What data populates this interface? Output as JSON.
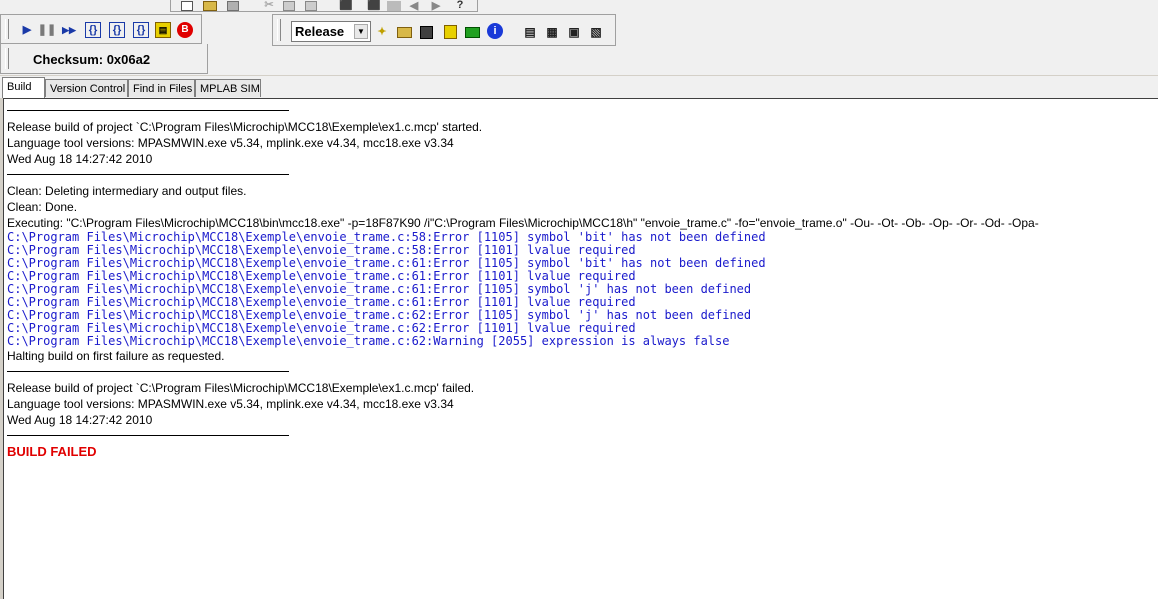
{
  "toolbar": {
    "top_icons": [
      "new-file-icon",
      "open-folder-icon",
      "save-icon",
      "cut-icon",
      "copy-icon",
      "paste-icon",
      "undo-icon",
      "redo-icon",
      "help-icon"
    ],
    "debug_icons": [
      {
        "name": "run-icon",
        "glyph": "▶",
        "color": "#1a3aa8"
      },
      {
        "name": "halt-icon",
        "glyph": "❚❚",
        "color": "#7a7a7a"
      },
      {
        "name": "animate-icon",
        "glyph": "▶▶",
        "color": "#1a3aa8"
      },
      {
        "name": "step-into-icon",
        "glyph": "{}",
        "color": "#1a3aa8"
      },
      {
        "name": "step-over-icon",
        "glyph": "{}",
        "color": "#1a3aa8"
      },
      {
        "name": "step-out-icon",
        "glyph": "{}",
        "color": "#1a3aa8"
      },
      {
        "name": "reset-icon",
        "glyph": "▤",
        "color": "#b8a000"
      },
      {
        "name": "breakpoint-icon",
        "glyph": "B",
        "color": "#ffffff"
      }
    ],
    "build_config": "Release",
    "build_icons": [
      "new-project-icon",
      "open-project-icon",
      "save-project-icon",
      "build-icon",
      "make-icon",
      "info-icon",
      "project-view-icon",
      "output-icon",
      "memory-icon",
      "watch-icon"
    ],
    "checksum_label": "Checksum:  0x06a2"
  },
  "tabs": [
    "Build",
    "Version Control",
    "Find in Files",
    "MPLAB SIM"
  ],
  "output": {
    "started_1": "Release build of project `C:\\Program Files\\Microchip\\MCC18\\Exemple\\ex1.c.mcp' started.",
    "versions_1": "Language tool versions: MPASMWIN.exe v5.34, mplink.exe v4.34, mcc18.exe v3.34",
    "date_1": "Wed Aug 18 14:27:42 2010",
    "clean_1": "Clean: Deleting intermediary and output files.",
    "clean_2": "Clean: Done.",
    "executing": "Executing: \"C:\\Program Files\\Microchip\\MCC18\\bin\\mcc18.exe\" -p=18F87K90 /i\"C:\\Program Files\\Microchip\\MCC18\\h\" \"envoie_trame.c\" -fo=\"envoie_trame.o\" -Ou- -Ot- -Ob- -Op- -Or- -Od- -Opa-",
    "errors": [
      "C:\\Program Files\\Microchip\\MCC18\\Exemple\\envoie_trame.c:58:Error [1105] symbol 'bit' has not been defined",
      "C:\\Program Files\\Microchip\\MCC18\\Exemple\\envoie_trame.c:58:Error [1101] lvalue required",
      "C:\\Program Files\\Microchip\\MCC18\\Exemple\\envoie_trame.c:61:Error [1105] symbol 'bit' has not been defined",
      "C:\\Program Files\\Microchip\\MCC18\\Exemple\\envoie_trame.c:61:Error [1101] lvalue required",
      "C:\\Program Files\\Microchip\\MCC18\\Exemple\\envoie_trame.c:61:Error [1105] symbol 'j' has not been defined",
      "C:\\Program Files\\Microchip\\MCC18\\Exemple\\envoie_trame.c:61:Error [1101] lvalue required",
      "C:\\Program Files\\Microchip\\MCC18\\Exemple\\envoie_trame.c:62:Error [1105] symbol 'j' has not been defined",
      "C:\\Program Files\\Microchip\\MCC18\\Exemple\\envoie_trame.c:62:Error [1101] lvalue required",
      "C:\\Program Files\\Microchip\\MCC18\\Exemple\\envoie_trame.c:62:Warning [2055] expression is always false"
    ],
    "halting": "Halting build on first failure as requested.",
    "failed_1": "Release build of project `C:\\Program Files\\Microchip\\MCC18\\Exemple\\ex1.c.mcp' failed.",
    "versions_2": "Language tool versions: MPASMWIN.exe v5.34, mplink.exe v4.34, mcc18.exe v3.34",
    "date_2": "Wed Aug 18 14:27:42 2010",
    "build_failed": "BUILD FAILED"
  }
}
